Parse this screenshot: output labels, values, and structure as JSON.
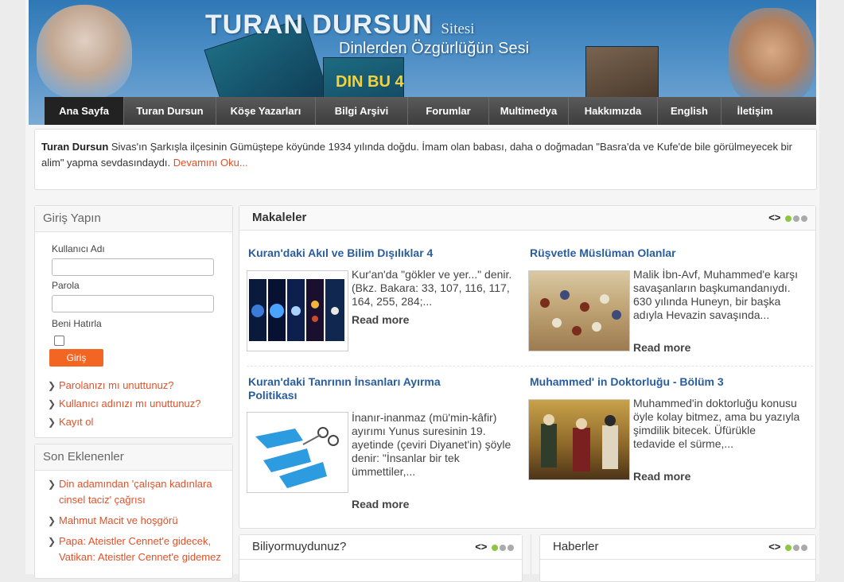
{
  "header": {
    "site_title": "TURAN DURSUN",
    "site_title_suffix": "Sitesi",
    "subtitle": "Dinlerden Özgürlüğün Sesi",
    "book_title": "DIN BU 4"
  },
  "nav": {
    "items": [
      {
        "label": "Ana Sayfa",
        "active": true
      },
      {
        "label": "Turan Dursun"
      },
      {
        "label": "Köşe Yazarları"
      },
      {
        "label": "Bilgi Arşivi"
      },
      {
        "label": "Forumlar"
      },
      {
        "label": "Multimedya"
      },
      {
        "label": "Hakkımızda"
      },
      {
        "label": "English"
      },
      {
        "label": "İletişim"
      }
    ]
  },
  "intro": {
    "name": "Turan Dursun",
    "text": " Sivas'ın Şarkışla ilçesinin Gümüştepe köyünde 1934 yılında doğdu. İmam olan babası, daha o doğmadan \"Basra'da ve Kufe'de bile görülmeyecek bir alim\" yapma sevdasındaydı. ",
    "more": "Devamını Oku..."
  },
  "login": {
    "title": "Giriş Yapın",
    "username_label": "Kullanıcı Adı",
    "password_label": "Parola",
    "remember_label": "Beni Hatırla",
    "button": "Giriş",
    "links": [
      "Parolanızı mı unuttunuz?",
      "Kullanıcı adınızı mı unuttunuz?",
      "Kayıt ol"
    ]
  },
  "recent": {
    "title": "Son Eklenenler",
    "items": [
      "Din adamından 'çalışan kadınlara cinsel taciz' çağrısı",
      "Mahmut Macit ve hoşgörü",
      "Papa: Ateistler Cennet'e gidecek, Vatikan: Ateistler Cennet'e gidemez"
    ]
  },
  "makaleler": {
    "title": "Makaleler",
    "pager": "<>",
    "articles": [
      {
        "title": "Kuran'daki Akıl ve Bilim Dışılıklar 4",
        "text": "Kur'an'da \"gökler ve yer...\" denir. (Bkz. Bakara: 33, 107, 116, 117, 164, 255, 284;...",
        "more": "Read more"
      },
      {
        "title": "Rüşvetle Müslüman Olanlar",
        "text": "Malik İbn-Avf, Muhammed'e karşı savaşanların başkumandanıydı. 630 yılında Huneyn, bir başka adıyla Hevazin savaşında...",
        "more": "Read more"
      },
      {
        "title": "Kuran'daki Tanrının İnsanları Ayırma Politikası",
        "text": "İnanır-inanmaz (mü'min-kâfir) ayırımı Yunus suresinin 19. ayetinde (çeviri Diyanet'in) şöyle denir: \"İnsanlar bir tek ümmettiler,...",
        "more": "Read more"
      },
      {
        "title": "Muhammed' in Doktorluğu - Bölüm 3",
        "text": "Muhammed'in doktorluğu konusu öyle kolay bitmez, ama bu yazıyla şimdilik bitecek. Üfürükle tedavide el sürme,...",
        "more": "Read more"
      }
    ]
  },
  "bottom": {
    "left_title": "Biliyormuydunuz?",
    "right_title": "Haberler"
  }
}
